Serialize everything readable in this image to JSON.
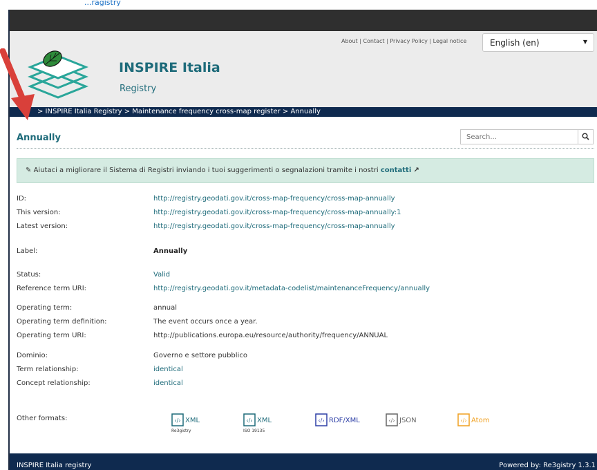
{
  "top_link": "...ragistry",
  "header": {
    "title": "INSPIRE Italia",
    "subtitle": "Registry",
    "links": [
      "About",
      "Contact",
      "Privacy Policy",
      "Legal notice"
    ],
    "language": "English (en)"
  },
  "breadcrumb": "> INSPIRE Italia Registry > Maintenance frequency cross-map register > Annually",
  "page": {
    "title": "Annually",
    "search_placeholder": "Search..."
  },
  "notice": {
    "text": "Aiutaci a migliorare il Sistema di Registri inviando i tuoi suggerimenti o segnalazioni tramite i nostri",
    "link": "contatti"
  },
  "fields": [
    {
      "label": "ID:",
      "value": "http://registry.geodati.gov.it/cross-map-frequency/cross-map-annually"
    },
    {
      "label": "This version:",
      "value": "http://registry.geodati.gov.it/cross-map-frequency/cross-map-annually:1"
    },
    {
      "label": "Latest version:",
      "value": "http://registry.geodati.gov.it/cross-map-frequency/cross-map-annually"
    },
    {
      "label": "Label:",
      "value": "Annually"
    },
    {
      "label": "Status:",
      "value": "Valid"
    },
    {
      "label": "Reference term URI:",
      "value": "http://registry.geodati.gov.it/metadata-codelist/maintenanceFrequency/annually"
    },
    {
      "label": "Operating term:",
      "value": "annual"
    },
    {
      "label": "Operating term definition:",
      "value": "The event occurs once a year."
    },
    {
      "label": "Operating term URI:",
      "value": "http://publications.europa.eu/resource/authority/frequency/ANNUAL"
    },
    {
      "label": "Dominio:",
      "value": "Governo e settore pubblico"
    },
    {
      "label": "Term relationship:",
      "value": "identical"
    },
    {
      "label": "Concept relationship:",
      "value": "identical"
    }
  ],
  "formats": {
    "label": "Other formats:",
    "items": [
      {
        "name": "XML",
        "sub": "Re3gistry",
        "color": "#1e6b7a"
      },
      {
        "name": "XML",
        "sub": "ISO 19135",
        "color": "#1e6b7a"
      },
      {
        "name": "RDF/XML",
        "sub": "",
        "color": "#2d3fa6"
      },
      {
        "name": "JSON",
        "sub": "",
        "color": "#666666"
      },
      {
        "name": "Atom",
        "sub": "",
        "color": "#f0a020"
      }
    ]
  },
  "footer": {
    "left": "INSPIRE Italia registry",
    "right": "Powered by: Re3gistry 1.3.1"
  },
  "colors": {
    "brand": "#1e6b7a",
    "nav": "#0f2a4f",
    "notice_bg": "#d5ebe2",
    "annotation_arrow": "#d9403a"
  }
}
